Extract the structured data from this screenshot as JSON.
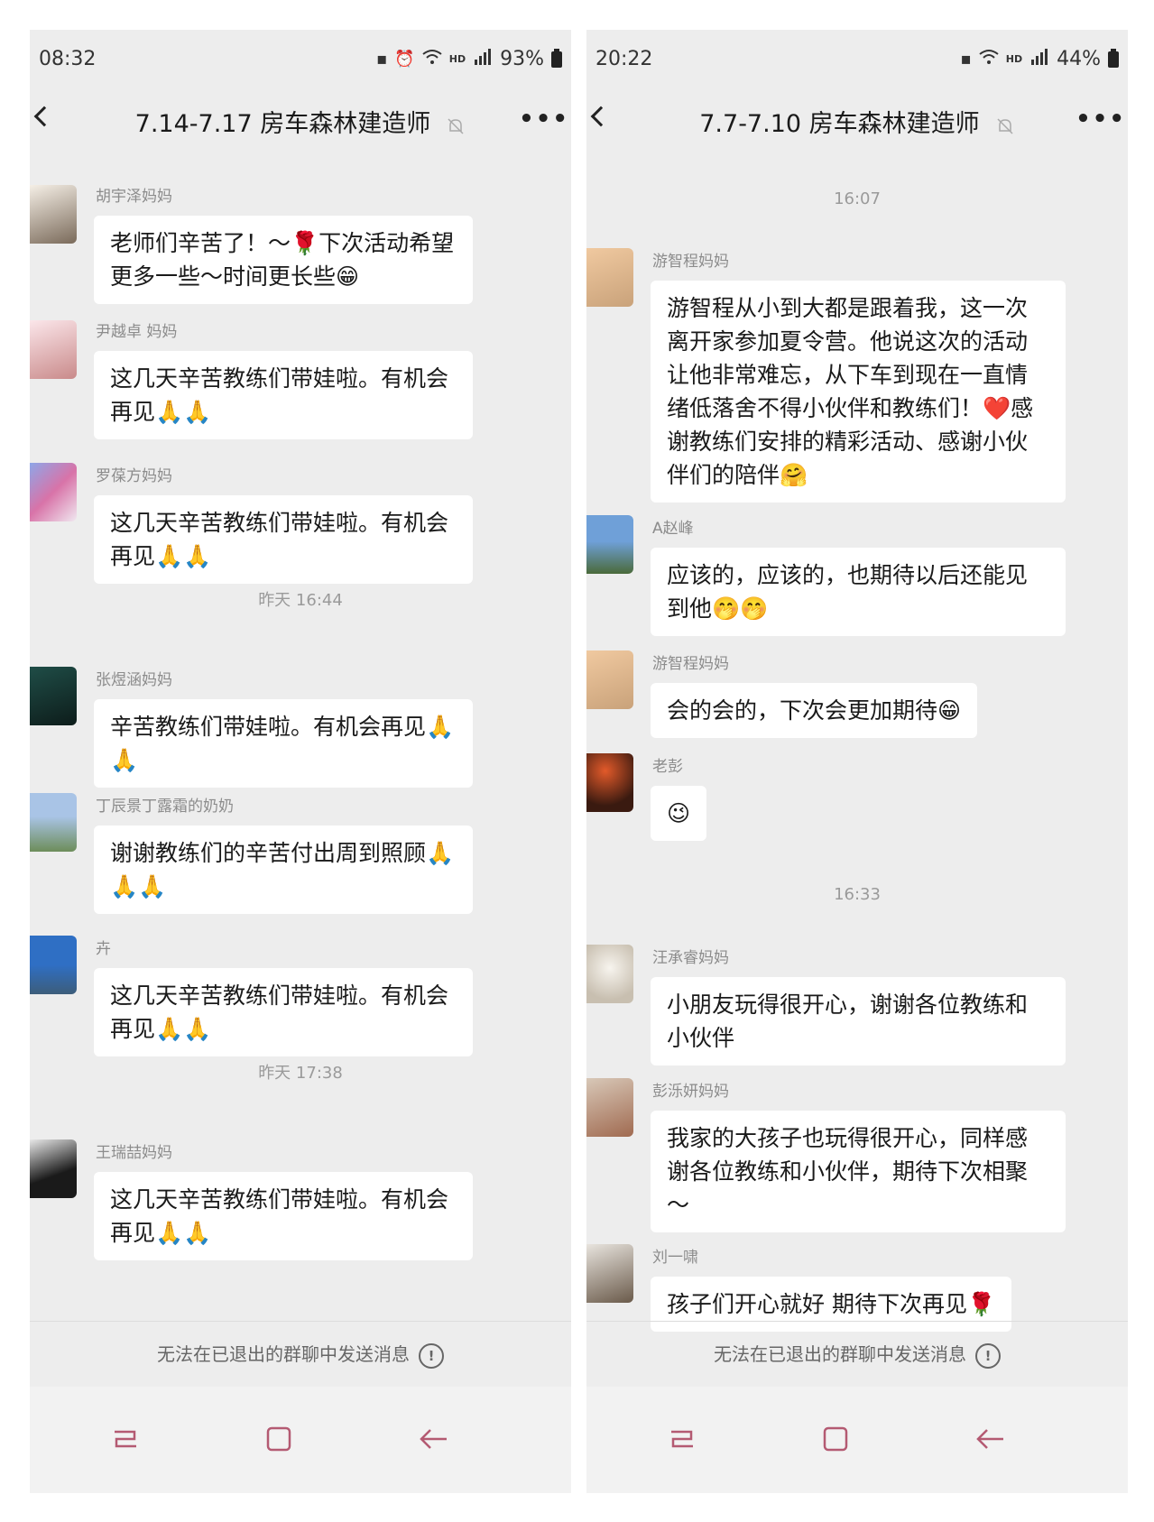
{
  "left": {
    "status": {
      "time": "08:32",
      "battery": "93%"
    },
    "header": {
      "title": "7.14-7.17 房车森林建造师"
    },
    "messages": [
      {
        "sender": "胡宇泽妈妈",
        "text": "老师们辛苦了！～🌹下次活动希望更多一些～时间更长些😁"
      },
      {
        "sender": "尹越卓 妈妈",
        "text": "这几天辛苦教练们带娃啦。有机会再见🙏🙏"
      },
      {
        "sender": "罗葆方妈妈",
        "text": "这几天辛苦教练们带娃啦。有机会再见🙏🙏"
      },
      {
        "sender": "张煜涵妈妈",
        "text": "辛苦教练们带娃啦。有机会再见🙏🙏"
      },
      {
        "sender": "丁辰景丁露霜的奶奶",
        "text": "谢谢教练们的辛苦付出周到照顾🙏🙏🙏"
      },
      {
        "sender": "卉",
        "text": "这几天辛苦教练们带娃啦。有机会再见🙏🙏"
      },
      {
        "sender": "王瑞喆妈妈",
        "text": "这几天辛苦教练们带娃啦。有机会再见🙏🙏"
      }
    ],
    "timestamps": [
      "昨天 16:44",
      "昨天 17:38"
    ],
    "footer_note": "无法在已退出的群聊中发送消息"
  },
  "right": {
    "status": {
      "time": "20:22",
      "battery": "44%"
    },
    "header": {
      "title": "7.7-7.10 房车森林建造师"
    },
    "timestamps": [
      "16:07",
      "16:33"
    ],
    "messages": [
      {
        "sender": "游智程妈妈",
        "text": "游智程从小到大都是跟着我，这一次离开家参加夏令营。他说这次的活动让他非常难忘，从下车到现在一直情绪低落舍不得小伙伴和教练们！❤️感谢教练们安排的精彩活动、感谢小伙伴们的陪伴🤗"
      },
      {
        "sender": "A赵峰",
        "text": "应该的，应该的，也期待以后还能见到他🤭🤭"
      },
      {
        "sender": "游智程妈妈",
        "text": "会的会的，下次会更加期待😁"
      },
      {
        "sender": "老彭",
        "text": "😉"
      },
      {
        "sender": "汪承睿妈妈",
        "text": "小朋友玩得很开心，谢谢各位教练和小伙伴"
      },
      {
        "sender": "彭泺妍妈妈",
        "text": "我家的大孩子也玩得很开心，同样感谢各位教练和小伙伴，期待下次相聚～"
      },
      {
        "sender": "刘一啸",
        "text": "孩子们开心就好 期待下次再见🌹"
      }
    ],
    "footer_note": "无法在已退出的群聊中发送消息"
  },
  "icons": [
    "battery-icon",
    "alarm-icon",
    "wifi-icon",
    "signal-icon",
    "back-icon",
    "mute-bell-icon",
    "more-icon",
    "info-icon",
    "recent-apps-icon",
    "home-icon",
    "back-nav-icon"
  ]
}
